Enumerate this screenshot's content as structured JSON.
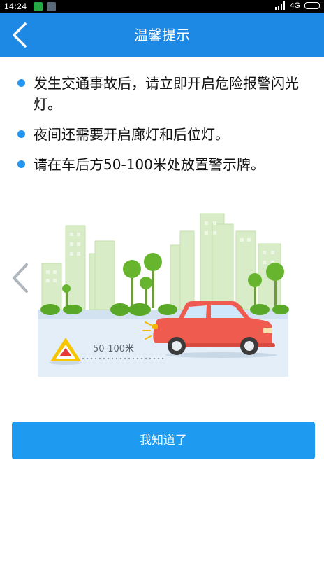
{
  "status": {
    "time": "14:24",
    "network": "4G"
  },
  "header": {
    "title": "温馨提示"
  },
  "tips": [
    "发生交通事故后，请立即开启危险报警闪光灯。",
    "夜间还需要开启廊灯和后位灯。",
    "请在车后方50-100米处放置警示牌。"
  ],
  "illustration": {
    "distance_label": "50-100米"
  },
  "actions": {
    "confirm_label": "我知道了"
  },
  "colors": {
    "header": "#1e88e5",
    "button": "#1e9bf0",
    "bullet": "#2196f3",
    "car": "#ef5b4f"
  }
}
